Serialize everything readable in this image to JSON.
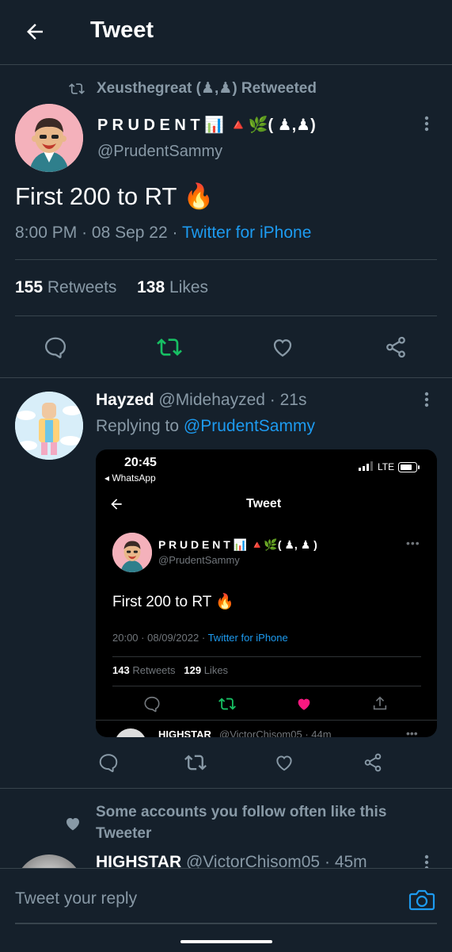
{
  "header": {
    "title": "Tweet"
  },
  "retweet_context": {
    "text": "Xeusthegreat (♟,♟) Retweeted"
  },
  "main_tweet": {
    "display_name": "P R U D E N T 📊 🔺🌿( ♟,♟)",
    "handle": "@PrudentSammy",
    "text": "First 200 to RT 🔥",
    "time": "8:00 PM",
    "sep1": "·",
    "date": "08 Sep 22",
    "sep2": "·",
    "source": "Twitter for iPhone",
    "retweets_count": "155",
    "retweets_label": "Retweets",
    "likes_count": "138",
    "likes_label": "Likes"
  },
  "reply": {
    "display_name": "Hayzed",
    "handle": "@Midehayzed",
    "sep": "·",
    "age": "21s",
    "replying_prefix": "Replying to",
    "replying_to": "@PrudentSammy"
  },
  "embedded_screenshot": {
    "status_time": "20:45",
    "back_app": "◂ WhatsApp",
    "network": "LTE",
    "title": "Tweet",
    "display_name": "P R U D E N T 📊 🔺🌿( ♟, ♟ )",
    "handle": "@PrudentSammy",
    "text": "First 200 to RT 🔥",
    "time": "20:00",
    "sep1": "·",
    "date": "08/09/2022",
    "sep2": "·",
    "source": "Twitter for iPhone",
    "retweets_count": "143",
    "retweets_label": "Retweets",
    "likes_count": "129",
    "likes_label": "Likes",
    "next_name": "HIGHSTAR",
    "next_handle": "@VictorChisom05 · 44m"
  },
  "suggestion": {
    "text": "Some accounts you follow often like this Tweeter"
  },
  "next_tweet": {
    "display_name": "HIGHSTAR",
    "handle": "@VictorChisom05",
    "sep": "·",
    "age": "45m"
  },
  "reply_bar": {
    "placeholder": "Tweet your reply"
  },
  "colors": {
    "background": "#15202b",
    "accent": "#1d9bf0",
    "retweet_green": "#17bf63",
    "text_secondary": "#8899a6",
    "like_pink": "#f91880"
  }
}
